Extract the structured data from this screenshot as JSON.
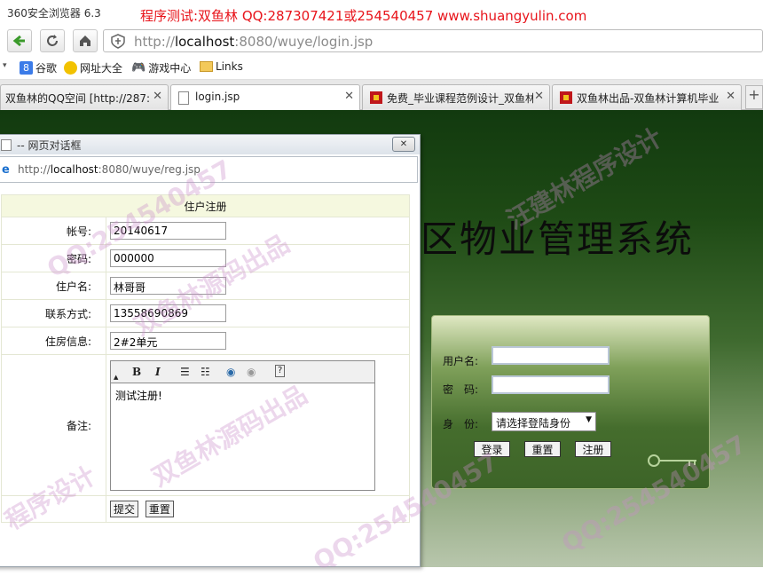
{
  "browser": {
    "app_title": "360安全浏览器 6.3",
    "watermark_line": "程序测试:双鱼林 QQ:287307421或254540457 www.shuangyulin.com",
    "address_url_prefix": "http://",
    "address_url_host": "localhost",
    "address_url_rest": ":8080/wuye/login.jsp"
  },
  "bookmarks": [
    {
      "label": "谷歌",
      "icon": "google-icon"
    },
    {
      "label": "网址大全",
      "icon": "site-directory-icon"
    },
    {
      "label": "游戏中心",
      "icon": "gamepad-icon"
    },
    {
      "label": "Links",
      "icon": "folder-icon"
    }
  ],
  "tabs": [
    {
      "label": "双鱼林的QQ空间 [http://287:",
      "active": false
    },
    {
      "label": "login.jsp",
      "active": true
    },
    {
      "label": "免费_毕业课程范例设计_双鱼林",
      "active": false
    },
    {
      "label": "双鱼林出品-双鱼林计算机毕业",
      "active": false
    }
  ],
  "page": {
    "system_title": "区物业管理系统",
    "login": {
      "username_label": "用户名:",
      "password_label": "密　码:",
      "identity_label": "身　份:",
      "identity_selected": "请选择登陆身份",
      "login_button": "登录",
      "reset_button": "重置",
      "register_button": "注册"
    }
  },
  "dialog": {
    "title": "-- 网页对话框",
    "close_label": "✕",
    "url_host_prefix": "http://",
    "url_host": "localhost",
    "url_rest": ":8080/wuye/reg.jsp",
    "form": {
      "header": "住户注册",
      "account_label": "帐号:",
      "account_value": "20140617",
      "password_label": "密码:",
      "password_value": "000000",
      "name_label": "住户名:",
      "name_value": "林哥哥",
      "contact_label": "联系方式:",
      "contact_value": "13558690869",
      "house_label": "住房信息:",
      "house_value": "2#2单元",
      "remark_label": "备注:",
      "remark_value": "测试注册!",
      "submit_button": "提交",
      "reset_button": "重置"
    }
  },
  "watermarks": [
    "QQ:254540457",
    "双鱼林源码出品",
    "程序设计",
    "汪建林程序设计"
  ]
}
